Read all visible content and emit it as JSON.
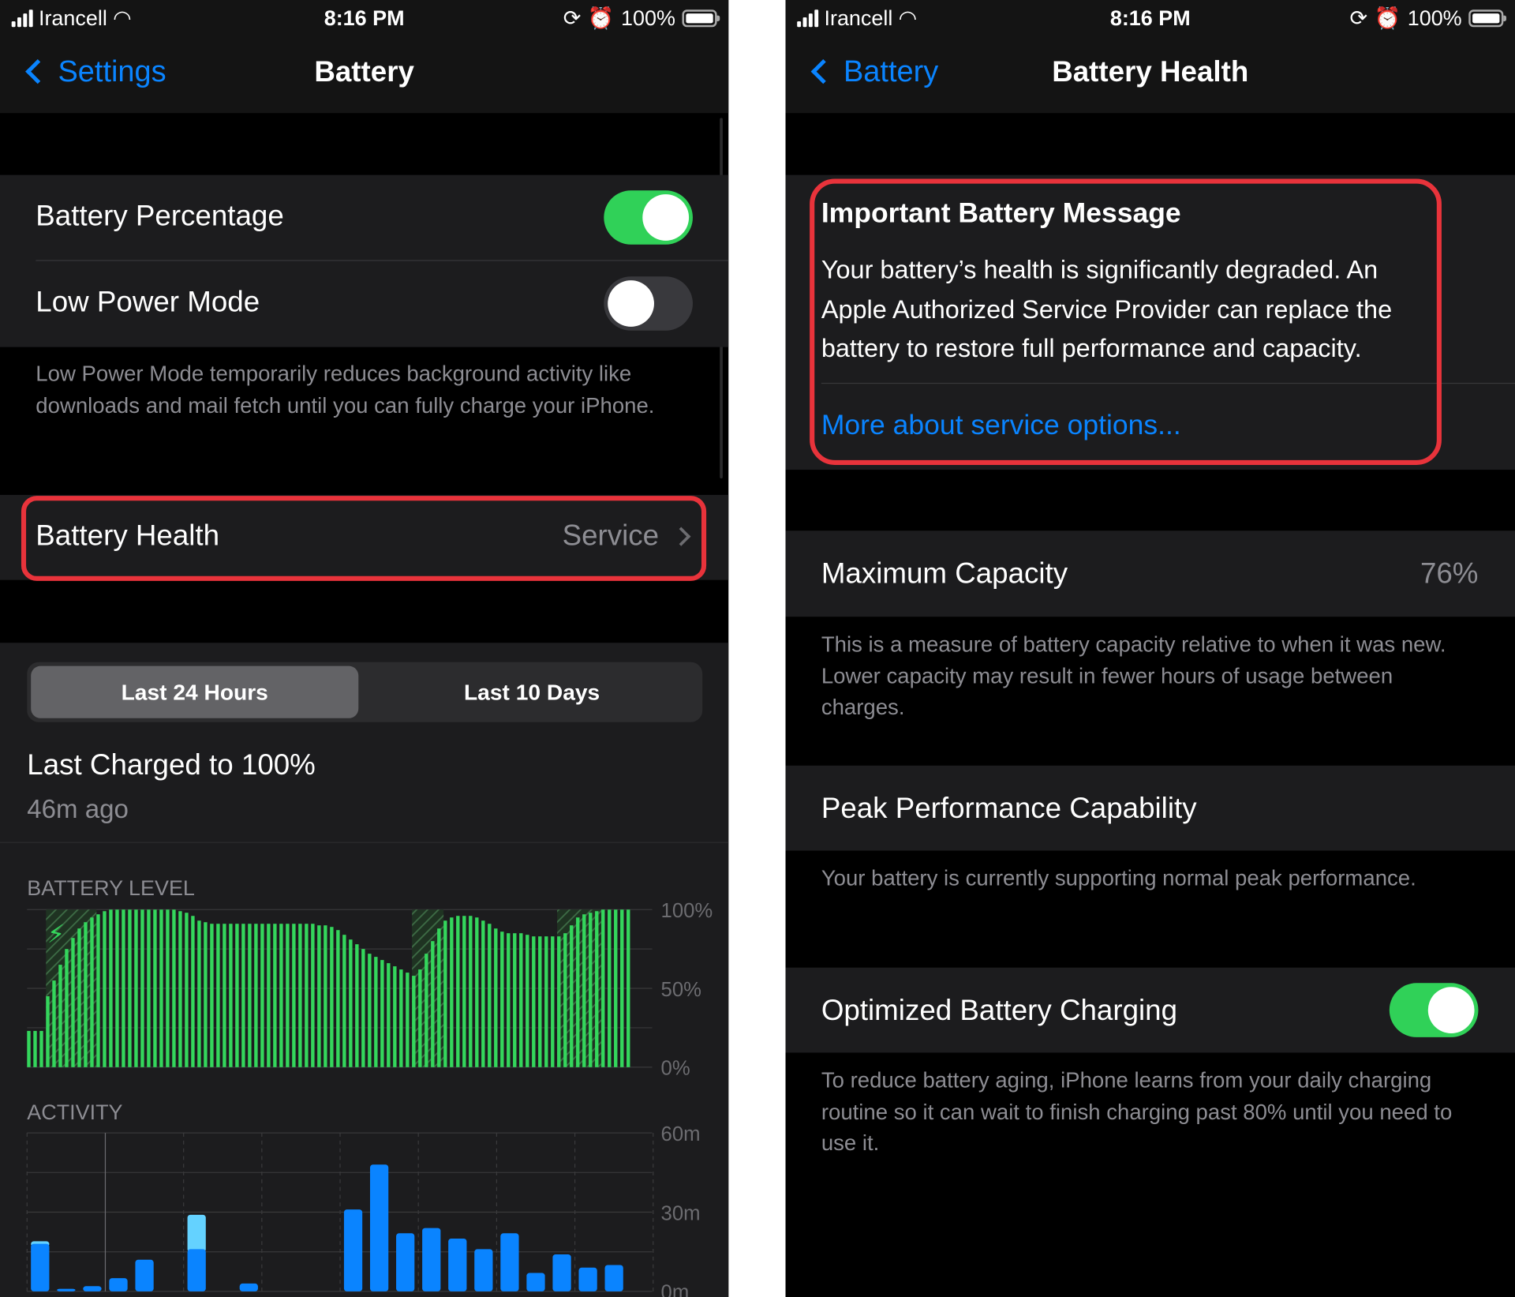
{
  "status_bar": {
    "carrier": "Irancell",
    "time": "8:16 PM",
    "battery_percent": "100%"
  },
  "colors": {
    "accent": "#0a84ff",
    "toggle_on": "#30d158",
    "battery_bar": "#34d65c",
    "activity_dark": "#0a84ff",
    "activity_light": "#64d2ff",
    "highlight": "#e8333b"
  },
  "left": {
    "nav": {
      "back_label": "Settings",
      "title": "Battery"
    },
    "battery_percentage": {
      "label": "Battery Percentage",
      "on": true
    },
    "low_power_mode": {
      "label": "Low Power Mode",
      "on": false
    },
    "low_power_footer": "Low Power Mode temporarily reduces background activity like downloads and mail fetch until you can fully charge your iPhone.",
    "battery_health": {
      "label": "Battery Health",
      "value": "Service"
    },
    "segments": [
      {
        "label": "Last 24 Hours",
        "selected": true
      },
      {
        "label": "Last 10 Days",
        "selected": false
      }
    ],
    "last_charged": {
      "title": "Last Charged to 100%",
      "subtitle": "46m ago"
    }
  },
  "chart_data": [
    {
      "type": "bar",
      "title": "BATTERY LEVEL",
      "y_ticks": [
        "100%",
        "50%",
        "0%"
      ],
      "ylim": [
        0,
        100
      ],
      "grid": true,
      "values": [
        23,
        23,
        23,
        45,
        55,
        65,
        75,
        82,
        88,
        92,
        95,
        97,
        99,
        100,
        100,
        100,
        100,
        100,
        100,
        100,
        100,
        100,
        100,
        100,
        99,
        98,
        96,
        93,
        92,
        91,
        91,
        91,
        91,
        91,
        91,
        91,
        91,
        91,
        91,
        91,
        91,
        91,
        91,
        91,
        91,
        91,
        90,
        90,
        89,
        87,
        84,
        81,
        78,
        75,
        72,
        70,
        68,
        66,
        64,
        62,
        60,
        58,
        62,
        72,
        80,
        88,
        93,
        95,
        96,
        96,
        96,
        95,
        93,
        91,
        88,
        86,
        85,
        85,
        85,
        84,
        83,
        83,
        83,
        83,
        83,
        85,
        90,
        95,
        97,
        98,
        99,
        100,
        100,
        100,
        100,
        100
      ],
      "charging_ranges": [
        [
          3,
          10
        ],
        [
          61,
          65
        ],
        [
          84,
          90
        ]
      ]
    },
    {
      "type": "bar",
      "title": "ACTIVITY",
      "y_ticks": [
        "60m",
        "30m",
        "0m"
      ],
      "ylim": [
        0,
        60
      ],
      "grid": true,
      "series": [
        {
          "values": [
            18,
            1,
            2,
            5,
            12,
            0,
            16,
            0,
            3,
            0,
            0,
            0,
            31,
            48,
            22,
            24,
            20,
            16,
            22,
            7,
            14,
            9,
            10
          ]
        },
        {
          "values": [
            1,
            0,
            0,
            0,
            0,
            0,
            13,
            0,
            0,
            0,
            0,
            0,
            0,
            0,
            0,
            0,
            0,
            0,
            0,
            0,
            0,
            0,
            0
          ]
        }
      ]
    }
  ],
  "right": {
    "nav": {
      "back_label": "Battery",
      "title": "Battery Health"
    },
    "message": {
      "title": "Important Battery Message",
      "lines": [
        "Your battery’s health is significantly degraded. An",
        "Apple Authorized Service Provider can replace the",
        "battery to restore full performance and capacity."
      ],
      "link": "More about service options..."
    },
    "max_capacity": {
      "label": "Maximum Capacity",
      "value": "76%",
      "footer": "This is a measure of battery capacity relative to when it was new. Lower capacity may result in fewer hours of usage between charges."
    },
    "peak_performance": {
      "label": "Peak Performance Capability",
      "footer": "Your battery is currently supporting normal peak performance."
    },
    "optimized_charging": {
      "label": "Optimized Battery Charging",
      "on": true,
      "footer": "To reduce battery aging, iPhone learns from your daily charging routine so it can wait to finish charging past 80% until you need to use it."
    }
  }
}
